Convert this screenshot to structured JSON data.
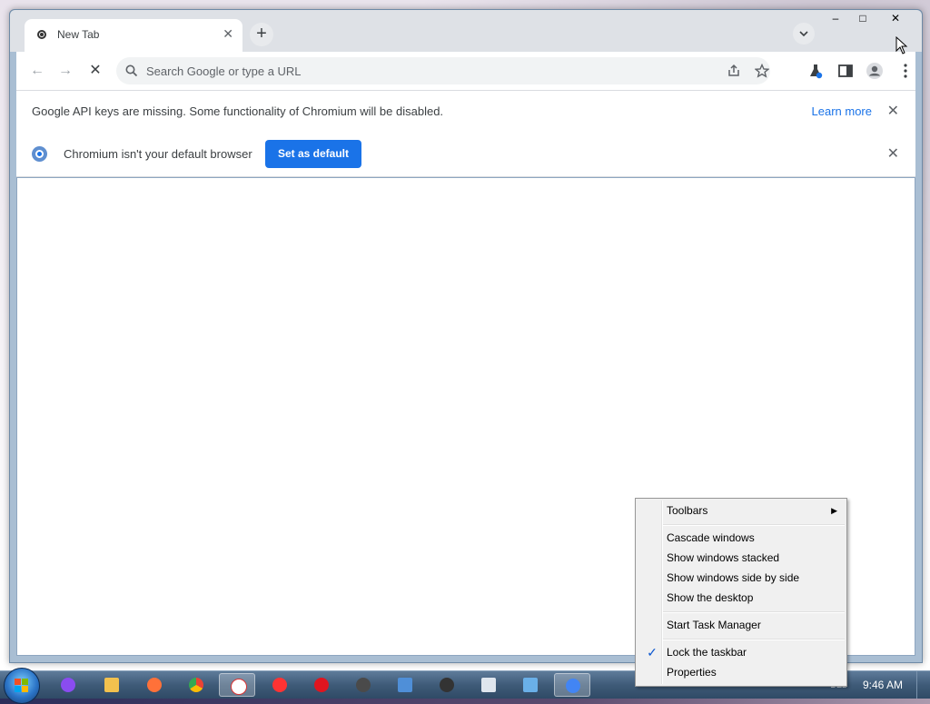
{
  "window": {
    "tab_title": "New Tab",
    "win_min": "–",
    "win_max": "□",
    "win_close": "✕"
  },
  "toolbar": {
    "back_icon": "←",
    "forward_icon": "→",
    "reload_icon": "✕",
    "search_placeholder": "Search Google or type a URL"
  },
  "infobar_keys": {
    "text": "Google API keys are missing. Some functionality of Chromium will be disabled.",
    "link": "Learn more",
    "close": "✕"
  },
  "infobar_default": {
    "text": "Chromium isn't your default browser",
    "button": "Set as default",
    "close": "✕"
  },
  "taskbar": {
    "time": "9:46 AM",
    "lang": "DEL",
    "apps": [
      {
        "name": "start",
        "color": "#2b74c7"
      },
      {
        "name": "alice",
        "color": "#8a4cf0"
      },
      {
        "name": "explorer",
        "color": "#f2c14e"
      },
      {
        "name": "firefox",
        "color": "#ff7139"
      },
      {
        "name": "chrome",
        "color": "#34a853"
      },
      {
        "name": "yandex-browser",
        "color": "#ffffff"
      },
      {
        "name": "yandex",
        "color": "#ff3333"
      },
      {
        "name": "opera",
        "color": "#e0151f"
      },
      {
        "name": "monster",
        "color": "#4a4a4a"
      },
      {
        "name": "paint",
        "color": "#4f8fd8"
      },
      {
        "name": "bug-app",
        "color": "#333333"
      },
      {
        "name": "sign-app",
        "color": "#dfe6ee"
      },
      {
        "name": "monitor",
        "color": "#6ab0e8"
      },
      {
        "name": "chromium",
        "color": "#4285f4"
      }
    ]
  },
  "context_menu": {
    "toolbars": "Toolbars",
    "arrow": "▶",
    "cascade": "Cascade windows",
    "stacked": "Show windows stacked",
    "side_by_side": "Show windows side by side",
    "show_desktop": "Show the desktop",
    "task_manager": "Start Task Manager",
    "lock": "Lock the taskbar",
    "check": "✓",
    "properties": "Properties"
  }
}
